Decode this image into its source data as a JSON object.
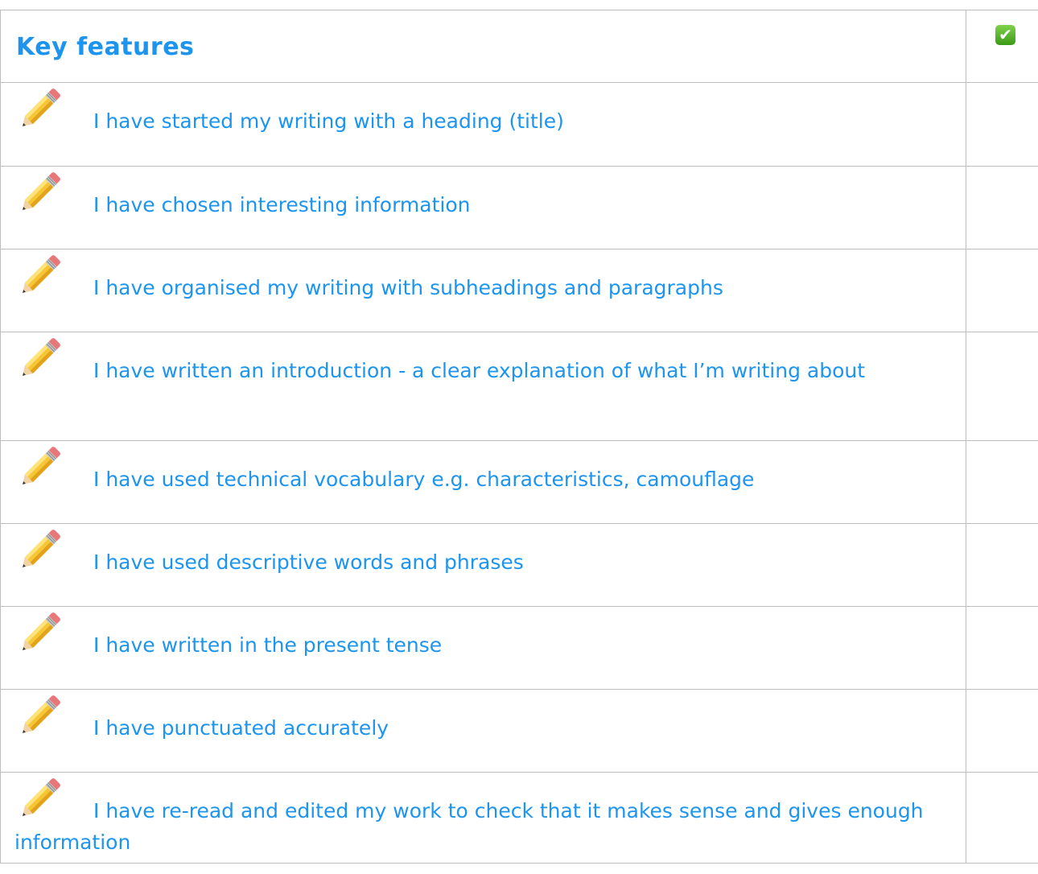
{
  "table": {
    "header": {
      "title": "Key features",
      "tick_icon": "check-box-icon",
      "tick_symbol": "✔"
    },
    "items": [
      {
        "icon": "pencil-icon",
        "text": "I have started my writing with a heading (title)"
      },
      {
        "icon": "pencil-icon",
        "text": "I have chosen interesting information"
      },
      {
        "icon": "pencil-icon",
        "text": "I have organised my writing with subheadings and paragraphs"
      },
      {
        "icon": "pencil-icon",
        "text": "I have written an introduction - a clear explanation of what I’m writing about"
      },
      {
        "icon": "pencil-icon",
        "text": "I have used technical vocabulary e.g. characteristics, camouflage"
      },
      {
        "icon": "pencil-icon",
        "text": "I have used descriptive words and phrases"
      },
      {
        "icon": "pencil-icon",
        "text": "I have written in the present tense"
      },
      {
        "icon": "pencil-icon",
        "text": "I have punctuated accurately"
      },
      {
        "icon": "pencil-icon",
        "text": "I have re-read and edited my work to check that it makes sense and gives enough information"
      }
    ]
  },
  "colors": {
    "text": "#1d94ee",
    "border": "#bdbdbd",
    "tick": "#3c9a16"
  }
}
